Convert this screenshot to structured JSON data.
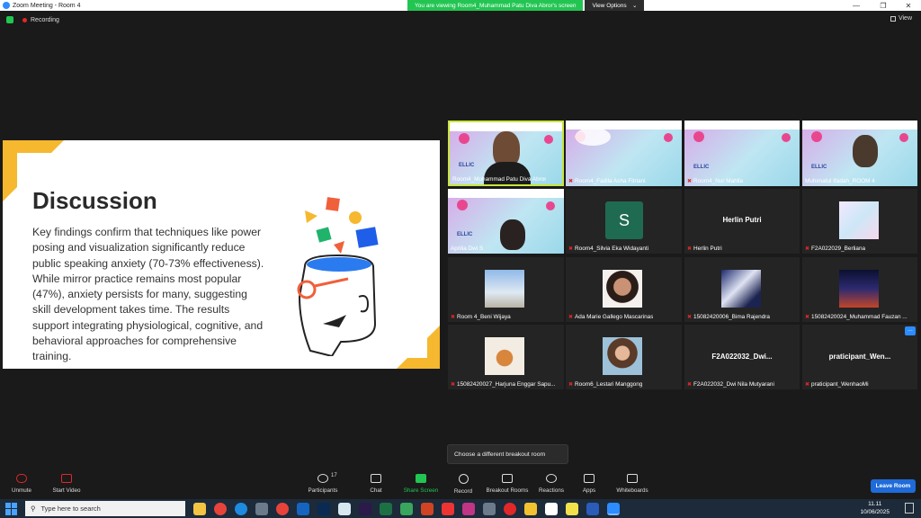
{
  "window": {
    "title": "Zoom Meeting - Room 4"
  },
  "view_banner": {
    "message": "You are viewing Room4_Muhammad Patu Diva Abror's screen",
    "options_label": "View Options"
  },
  "status": {
    "recording_label": "Recording",
    "view_label": "View"
  },
  "slide": {
    "title": "Discussion",
    "body": "Key findings confirm that techniques like power posing and visualization significantly reduce public speaking anxiety (70-73% effectiveness). While mirror practice remains most popular (47%), anxiety persists for many, suggesting skill development takes time. The results support integrating physiological, cognitive, and behavioral approaches for comprehensive training."
  },
  "participants_grid": [
    {
      "name": "Room4_Muhammad Patu Diva Abror",
      "type": "video",
      "active": true
    },
    {
      "name": "Room4_Fadila Asha Fitriani",
      "type": "video"
    },
    {
      "name": "Room4_Nur Mahlla",
      "type": "video"
    },
    {
      "name": "Muhimatul Ifadah_ROOM 4",
      "type": "video"
    },
    {
      "name": "Aprilia Dwi S",
      "type": "video"
    },
    {
      "name": "Room4_Silvia Eka Widayanti",
      "type": "initial",
      "initial": "S"
    },
    {
      "name": "Herlin Putri",
      "type": "text",
      "display": "Herlin Putri"
    },
    {
      "name": "F2A022029_Berliana",
      "type": "image"
    },
    {
      "name": "Room 4_Beni Wijaya",
      "type": "image"
    },
    {
      "name": "Ada Marie Gallego Mascarinas",
      "type": "image"
    },
    {
      "name": "15082420006_Bima Rajendra",
      "type": "image"
    },
    {
      "name": "15082420024_Muhammad Fauzan ...",
      "type": "image"
    },
    {
      "name": "15082420027_Harjuna Enggar Sapu...",
      "type": "image"
    },
    {
      "name": "Room6_Lestari Manggong",
      "type": "image"
    },
    {
      "name": "F2A022032_Dwi Nila Mutyarani",
      "type": "text",
      "display": "F2A022032_Dwi..."
    },
    {
      "name": "praticipant_WenhaoMi",
      "type": "text",
      "display": "praticipant_Wen..."
    }
  ],
  "tooltip": "Choose a different breakout room",
  "controls": {
    "unmute": "Unmute",
    "start_video": "Start Video",
    "participants": "Participants",
    "participants_count": "17",
    "chat": "Chat",
    "share_screen": "Share Screen",
    "record": "Record",
    "breakout_rooms": "Breakout Rooms",
    "reactions": "Reactions",
    "apps": "Apps",
    "whiteboards": "Whiteboards",
    "leave": "Leave Room"
  },
  "taskbar": {
    "search_placeholder": "Type here to search",
    "time": "11.11",
    "date": "10/06/2025"
  },
  "colors": {
    "accent_green": "#23c552",
    "zoom_blue": "#2d8cff",
    "leave_blue": "#1f6bd9",
    "slide_yellow": "#f5b82e"
  }
}
